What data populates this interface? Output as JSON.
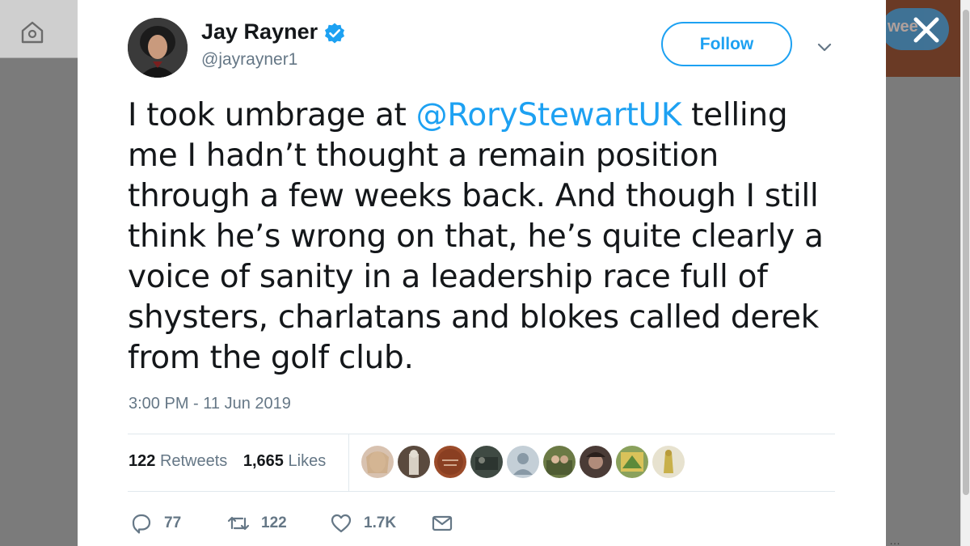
{
  "tweet": {
    "author": {
      "display_name": "Jay Rayner",
      "handle": "@jayrayner1",
      "verified": true
    },
    "follow_label": "Follow",
    "text_parts": {
      "before_mention": "I took umbrage at ",
      "mention": "@RoryStewartUK",
      "after_mention": " telling me I hadn’t thought a remain position through a few weeks back. And though I still think he’s wrong on that, he’s quite clearly a voice of sanity in a leadership race full of shysters, charlatans and blokes called derek from the golf club."
    },
    "timestamp": "3:00 PM - 11 Jun 2019",
    "stats": {
      "retweets_count": "122",
      "retweets_label": "Retweets",
      "likes_count": "1,665",
      "likes_label": "Likes"
    },
    "actions": {
      "replies": "77",
      "retweets": "122",
      "likes": "1.7K"
    }
  },
  "background": {
    "tweet_button_fragment": "wee"
  },
  "colors": {
    "accent": "#1da1f2",
    "muted_text": "#657786",
    "primary_text": "#14171a",
    "overlay": "#7b7b7b"
  },
  "icons": {
    "home": "home-icon",
    "verified": "verified-badge-icon",
    "caret": "chevron-down-icon",
    "close": "close-icon",
    "reply": "reply-icon",
    "retweet": "retweet-icon",
    "like": "heart-icon",
    "dm": "envelope-icon"
  }
}
